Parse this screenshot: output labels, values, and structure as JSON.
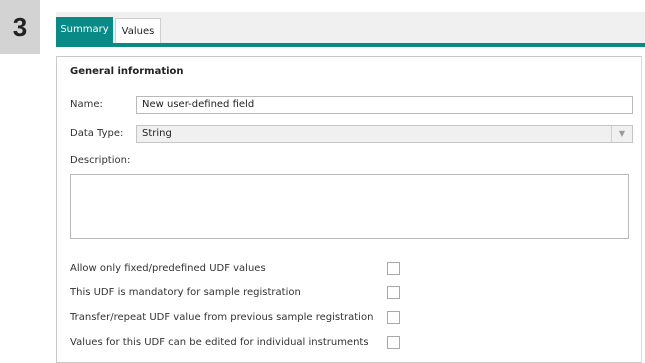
{
  "step": {
    "number": "3"
  },
  "tabs": [
    {
      "label": "Summary",
      "active": true
    },
    {
      "label": "Values",
      "active": false
    }
  ],
  "form": {
    "section_title": "General information",
    "name_label": "Name:",
    "name_value": "New user-defined field",
    "data_type_label": "Data Type:",
    "data_type_value": "String",
    "description_label": "Description:",
    "description_value": ""
  },
  "options": [
    {
      "label": "Allow only fixed/predefined UDF values",
      "checked": false
    },
    {
      "label": "This UDF is mandatory for sample registration",
      "checked": false
    },
    {
      "label": "Transfer/repeat UDF value from previous sample registration",
      "checked": false
    },
    {
      "label": "Values for this UDF can be edited for individual instruments",
      "checked": false
    }
  ],
  "colors": {
    "accent": "#0a8a86",
    "tab_bar_bg": "#f0f0f0",
    "step_badge_bg": "#d3d3d3"
  },
  "icons": {
    "select_arrow": "chevron-down-icon"
  }
}
